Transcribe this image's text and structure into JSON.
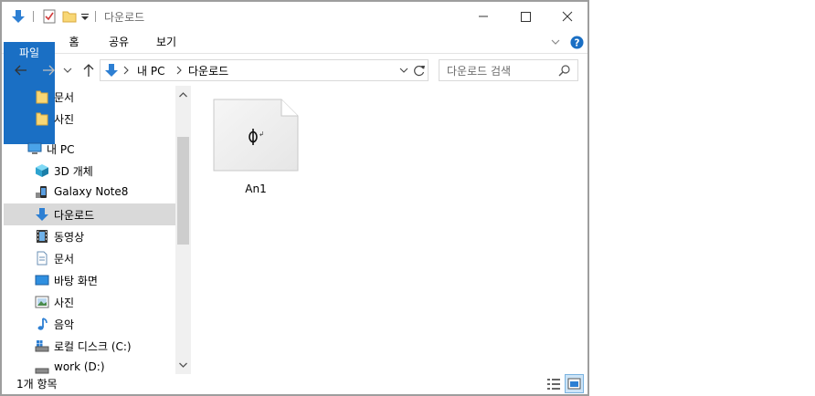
{
  "titlebar": {
    "title": "다운로드"
  },
  "ribbon": {
    "tabs": [
      "파일",
      "홈",
      "공유",
      "보기"
    ]
  },
  "address": {
    "crumbs": [
      "내 PC",
      "다운로드"
    ]
  },
  "search": {
    "placeholder": "다운로드 검색"
  },
  "nav": {
    "items": [
      {
        "label": "문서",
        "icon": "folder-icon"
      },
      {
        "label": "사진",
        "icon": "folder-icon"
      },
      {
        "label": "내 PC",
        "icon": "computer-icon"
      },
      {
        "label": "3D 개체",
        "icon": "cube-icon"
      },
      {
        "label": "Galaxy Note8",
        "icon": "phone-icon"
      },
      {
        "label": "다운로드",
        "icon": "download-icon"
      },
      {
        "label": "동영상",
        "icon": "film-icon"
      },
      {
        "label": "문서",
        "icon": "document-icon"
      },
      {
        "label": "바탕 화면",
        "icon": "desktop-icon"
      },
      {
        "label": "사진",
        "icon": "picture-icon"
      },
      {
        "label": "음악",
        "icon": "music-icon"
      },
      {
        "label": "로컬 디스크 (C:)",
        "icon": "drive-icon"
      },
      {
        "label": "work (D:)",
        "icon": "drive-icon"
      }
    ]
  },
  "files": [
    {
      "name": "An1"
    }
  ],
  "status": {
    "count": "1개 항목"
  },
  "colors": {
    "accent": "#1a6fc4",
    "selected": "#d9d9d9"
  }
}
